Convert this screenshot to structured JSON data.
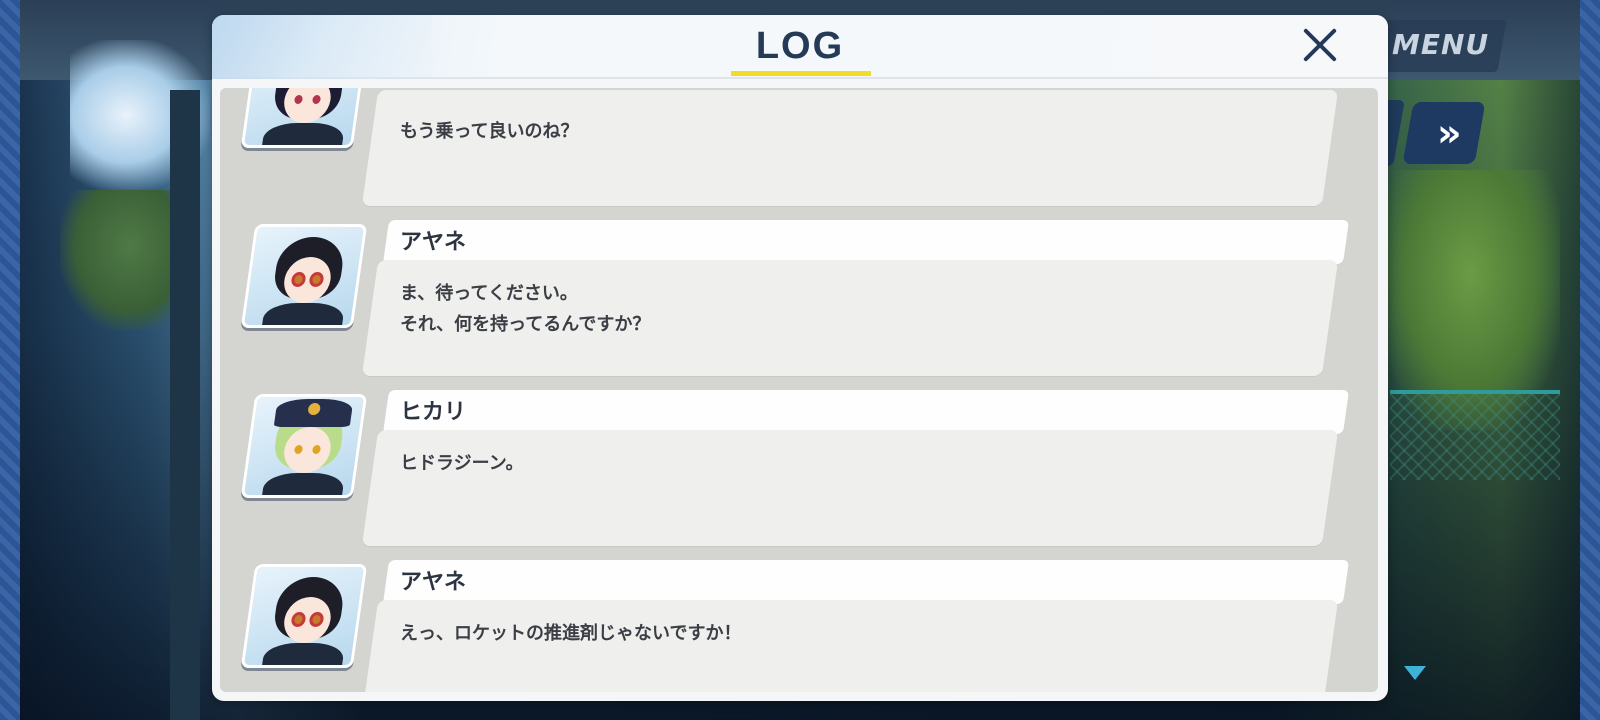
{
  "hud": {
    "menu_label": "MENU",
    "skip_icon": "»"
  },
  "log": {
    "title": "LOG",
    "close_icon": "close-icon",
    "entries": [
      {
        "speaker": "",
        "avatar": "avatar-dark-hair-girl",
        "text": "もう乗って良いのね？"
      },
      {
        "speaker": "アヤネ",
        "avatar": "avatar-ayane",
        "text": "ま、待ってください。\nそれ、何を持ってるんですか？"
      },
      {
        "speaker": "ヒカリ",
        "avatar": "avatar-hikari",
        "text": "ヒドラジーン。"
      },
      {
        "speaker": "アヤネ",
        "avatar": "avatar-ayane",
        "text": "えっ、ロケットの推進剤じゃないですか！"
      }
    ]
  },
  "colors": {
    "title_text": "#243a57",
    "title_underline": "#f3dc26",
    "name_bar": "#fefefe",
    "message_box": "#efefed",
    "log_body": "#d4d4d1",
    "next_indicator": "#3fb2d8"
  }
}
